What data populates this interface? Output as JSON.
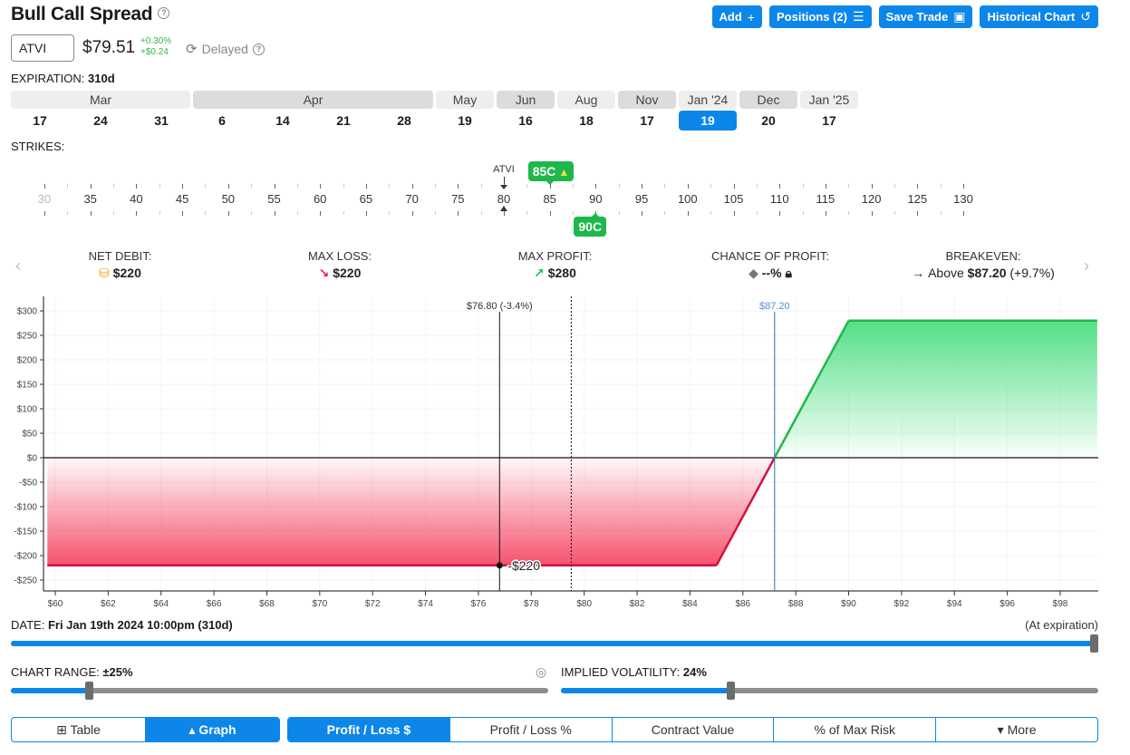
{
  "header": {
    "title": "Bull Call Spread",
    "buttons": [
      {
        "label": "Add",
        "icon": "+"
      },
      {
        "label": "Positions (2)",
        "icon": "☰"
      },
      {
        "label": "Save Trade",
        "icon": "💾"
      },
      {
        "label": "Historical Chart",
        "icon": "↺"
      }
    ]
  },
  "quote": {
    "ticker": "ATVI",
    "price": "$79.51",
    "change_pct": "+0.30%",
    "change_abs": "+$0.24",
    "status": "Delayed"
  },
  "expiration": {
    "label": "EXPIRATION:",
    "value": "310d",
    "months": [
      {
        "label": "Mar",
        "span": 3,
        "shade": "light"
      },
      {
        "label": "Apr",
        "span": 4,
        "shade": "dark"
      },
      {
        "label": "May",
        "span": 1,
        "shade": "light"
      },
      {
        "label": "Jun",
        "span": 1,
        "shade": "dark"
      },
      {
        "label": "Aug",
        "span": 1,
        "shade": "light"
      },
      {
        "label": "Nov",
        "span": 1,
        "shade": "dark"
      },
      {
        "label": "Jan '24",
        "span": 1,
        "shade": "light"
      },
      {
        "label": "Dec",
        "span": 1,
        "shade": "dark"
      },
      {
        "label": "Jan '25",
        "span": 1,
        "shade": "light"
      }
    ],
    "days": [
      "17",
      "24",
      "31",
      "6",
      "14",
      "21",
      "28",
      "19",
      "16",
      "18",
      "17",
      "19",
      "20",
      "17"
    ],
    "selected_index": 11
  },
  "strikes": {
    "label": "STRIKES:",
    "values": [
      "30",
      "35",
      "40",
      "45",
      "50",
      "55",
      "60",
      "65",
      "70",
      "75",
      "80",
      "85",
      "90",
      "95",
      "100",
      "105",
      "110",
      "115",
      "120",
      "125",
      "130"
    ],
    "underlying_label": "ATVI",
    "underlying_price": 79.51,
    "legs": [
      {
        "label": "85C",
        "strike": 85,
        "position": "above",
        "warning": true
      },
      {
        "label": "90C",
        "strike": 90,
        "position": "below",
        "warning": false
      }
    ]
  },
  "summary": {
    "net_debit": {
      "label": "NET DEBIT:",
      "value": "$220",
      "icon": "coins"
    },
    "max_loss": {
      "label": "MAX LOSS:",
      "value": "$220",
      "icon": "arrow-down-right"
    },
    "max_profit": {
      "label": "MAX PROFIT:",
      "value": "$280",
      "icon": "arrow-up-right"
    },
    "chance_of_profit": {
      "label": "CHANCE OF PROFIT:",
      "value": "--%",
      "icon": "lock"
    },
    "breakeven": {
      "label": "BREAKEVEN:",
      "prefix": "Above",
      "value": "$87.20",
      "suffix": "(+9.7%)"
    }
  },
  "chart_data": {
    "type": "area",
    "title": "",
    "xlabel": "",
    "ylabel": "",
    "x_ticks": [
      "$60",
      "$62",
      "$64",
      "$66",
      "$68",
      "$70",
      "$72",
      "$74",
      "$76",
      "$78",
      "$80",
      "$82",
      "$84",
      "$86",
      "$88",
      "$90",
      "$92",
      "$94",
      "$96",
      "$98"
    ],
    "x_tick_values": [
      60,
      62,
      64,
      66,
      68,
      70,
      72,
      74,
      76,
      78,
      80,
      82,
      84,
      86,
      88,
      90,
      92,
      94,
      96,
      98
    ],
    "y_ticks": [
      "$300",
      "$250",
      "$200",
      "$150",
      "$100",
      "$50",
      "$0",
      "-$50",
      "-$100",
      "-$150",
      "-$200",
      "-$250"
    ],
    "y_tick_values": [
      300,
      250,
      200,
      150,
      100,
      50,
      0,
      -50,
      -100,
      -150,
      -200,
      -250
    ],
    "xlim": [
      59.7,
      99.4
    ],
    "ylim": [
      -272,
      330
    ],
    "series": [
      {
        "name": "P/L at expiration",
        "x": [
          59.7,
          85,
          87.2,
          90,
          99.4
        ],
        "y": [
          -220,
          -220,
          0,
          280,
          280
        ]
      }
    ],
    "markers": {
      "cursor": {
        "x": 76.8,
        "label": "$76.80 (-3.4%)",
        "value_label": "-$220",
        "value": -220
      },
      "current_price": {
        "x": 79.51
      },
      "breakeven": {
        "x": 87.2,
        "label": "$87.20"
      }
    },
    "colors": {
      "profit": "#22c55e",
      "loss": "#e11d48",
      "breakeven": "#1f77b4",
      "breakeven_label": "#5b8bd9"
    },
    "grid": true,
    "legend": "none"
  },
  "date": {
    "label": "DATE:",
    "value": "Fri Jan 19th 2024 10:00pm (310d)",
    "note": "(At expiration)",
    "slider_fraction": 1.0
  },
  "chart_range": {
    "label": "CHART RANGE:",
    "value": "±25%",
    "slider_fraction": 0.145
  },
  "implied_volatility": {
    "label": "IMPLIED VOLATILITY:",
    "value": "24%",
    "slider_fraction": 0.315
  },
  "view_tabs": [
    {
      "label": "Table",
      "icon": "⊞",
      "active": false
    },
    {
      "label": "Graph",
      "icon": "▴",
      "active": true
    }
  ],
  "metric_tabs": [
    {
      "label": "Profit / Loss $",
      "active": true
    },
    {
      "label": "Profit / Loss %",
      "active": false
    },
    {
      "label": "Contract Value",
      "active": false
    },
    {
      "label": "% of Max Risk",
      "active": false
    },
    {
      "label": "▾ More",
      "active": false
    }
  ]
}
